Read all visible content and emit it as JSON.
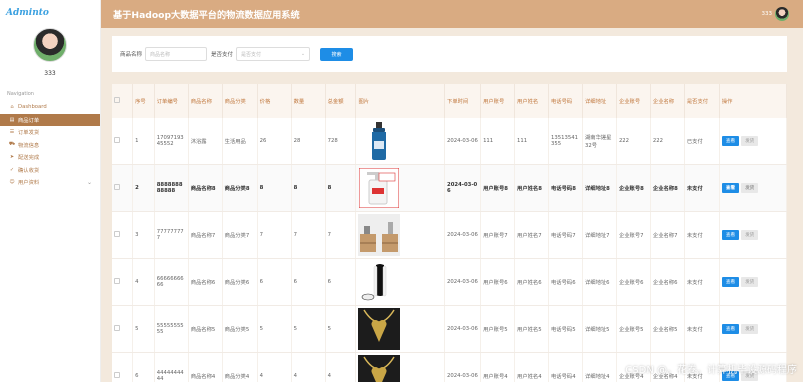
{
  "brand": "Adminto",
  "user": {
    "name": "333"
  },
  "nav": {
    "title": "Navigation",
    "items": [
      {
        "label": "Dashboard",
        "icon": "home-icon"
      },
      {
        "label": "商品订单",
        "icon": "cart-icon"
      },
      {
        "label": "订单发货",
        "icon": "list-icon"
      },
      {
        "label": "物流信息",
        "icon": "truck-icon"
      },
      {
        "label": "配送完成",
        "icon": "send-icon"
      },
      {
        "label": "确认收货",
        "icon": "check-icon"
      },
      {
        "label": "用户资料",
        "icon": "user-icon"
      }
    ]
  },
  "header": {
    "title": "基于Hadoop大数据平台的物流数据应用系统",
    "user": "333"
  },
  "search": {
    "name_label": "商品名称",
    "name_placeholder": "商品名称",
    "paid_label": "是否支付",
    "paid_placeholder": "是否支付",
    "button": "搜索"
  },
  "table": {
    "headers": [
      "序号",
      "订单编号",
      "商品名称",
      "商品分类",
      "价格",
      "数量",
      "总金额",
      "图片",
      "下单时间",
      "用户账号",
      "用户姓名",
      "电话号码",
      "详细地址",
      "企业账号",
      "企业名称",
      "是否支付",
      "操作"
    ],
    "view_label": "查看",
    "ship_label": "发货",
    "rows": [
      {
        "idx": "1",
        "order": "1709719345552",
        "name": "沐浴露",
        "category": "生活用品",
        "price": "26",
        "qty": "28",
        "total": "728",
        "image": "bottle",
        "time": "2024-03-06",
        "account": "111",
        "uname": "111",
        "phone": "13513541355",
        "address": "湖南华搓星32号",
        "ent_account": "222",
        "ent_name": "222",
        "paid": "已支付"
      },
      {
        "idx": "2",
        "order": "888888888888",
        "name": "商品名称8",
        "category": "商品分类8",
        "price": "8",
        "qty": "8",
        "total": "8",
        "image": "pump",
        "time": "2024-03-06",
        "account": "用户账号8",
        "uname": "用户姓名8",
        "phone": "电话号码8",
        "address": "详细地址8",
        "ent_account": "企业账号8",
        "ent_name": "企业名称8",
        "paid": "未支付"
      },
      {
        "idx": "3",
        "order": "777777777",
        "name": "商品名称7",
        "category": "商品分类7",
        "price": "7",
        "qty": "7",
        "total": "7",
        "image": "furniture",
        "time": "2024-03-06",
        "account": "用户账号7",
        "uname": "用户姓名7",
        "phone": "电话号码7",
        "address": "详细地址7",
        "ent_account": "企业账号7",
        "ent_name": "企业名称7",
        "paid": "未支付"
      },
      {
        "idx": "4",
        "order": "6666666666",
        "name": "商品名称6",
        "category": "商品分类6",
        "price": "6",
        "qty": "6",
        "total": "6",
        "image": "console",
        "time": "2024-03-06",
        "account": "用户账号6",
        "uname": "用户姓名6",
        "phone": "电话号码6",
        "address": "详细地址6",
        "ent_account": "企业账号6",
        "ent_name": "企业名称6",
        "paid": "未支付"
      },
      {
        "idx": "5",
        "order": "5555555555",
        "name": "商品名称5",
        "category": "商品分类5",
        "price": "5",
        "qty": "5",
        "total": "5",
        "image": "necklace",
        "time": "2024-03-06",
        "account": "用户账号5",
        "uname": "用户姓名5",
        "phone": "电话号码5",
        "address": "详细地址5",
        "ent_account": "企业账号5",
        "ent_name": "企业名称5",
        "paid": "未支付"
      },
      {
        "idx": "6",
        "order": "4444444444",
        "name": "商品名称4",
        "category": "商品分类4",
        "price": "4",
        "qty": "4",
        "total": "4",
        "image": "necklace",
        "time": "2024-03-06",
        "account": "用户账号4",
        "uname": "用户姓名4",
        "phone": "电话号码4",
        "address": "详细地址4",
        "ent_account": "企业账号4",
        "ent_name": "企业名称4",
        "paid": "未支付"
      }
    ]
  },
  "watermark": "CSDN @。花卷。计算机毕设源码程序",
  "colors": {
    "accent": "#b07a4a",
    "topbar": "#d9ab82",
    "primary_button": "#1e8de6"
  }
}
